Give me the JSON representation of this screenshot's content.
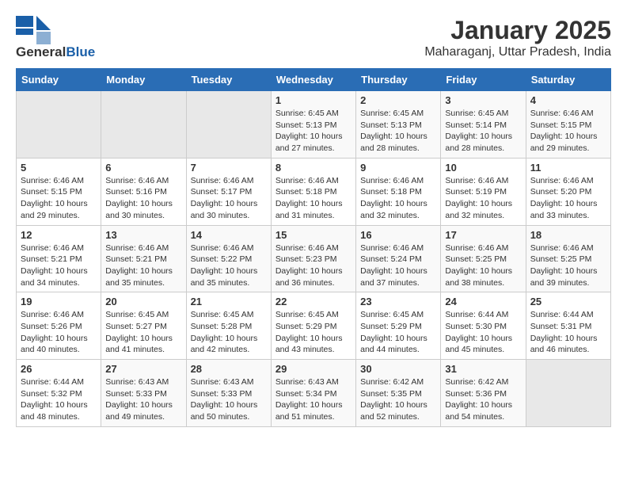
{
  "header": {
    "logo_general": "General",
    "logo_blue": "Blue",
    "title": "January 2025",
    "subtitle": "Maharaganj, Uttar Pradesh, India"
  },
  "calendar": {
    "days_of_week": [
      "Sunday",
      "Monday",
      "Tuesday",
      "Wednesday",
      "Thursday",
      "Friday",
      "Saturday"
    ],
    "weeks": [
      [
        {
          "day": "",
          "info": ""
        },
        {
          "day": "",
          "info": ""
        },
        {
          "day": "",
          "info": ""
        },
        {
          "day": "1",
          "info": "Sunrise: 6:45 AM\nSunset: 5:13 PM\nDaylight: 10 hours\nand 27 minutes."
        },
        {
          "day": "2",
          "info": "Sunrise: 6:45 AM\nSunset: 5:13 PM\nDaylight: 10 hours\nand 28 minutes."
        },
        {
          "day": "3",
          "info": "Sunrise: 6:45 AM\nSunset: 5:14 PM\nDaylight: 10 hours\nand 28 minutes."
        },
        {
          "day": "4",
          "info": "Sunrise: 6:46 AM\nSunset: 5:15 PM\nDaylight: 10 hours\nand 29 minutes."
        }
      ],
      [
        {
          "day": "5",
          "info": "Sunrise: 6:46 AM\nSunset: 5:15 PM\nDaylight: 10 hours\nand 29 minutes."
        },
        {
          "day": "6",
          "info": "Sunrise: 6:46 AM\nSunset: 5:16 PM\nDaylight: 10 hours\nand 30 minutes."
        },
        {
          "day": "7",
          "info": "Sunrise: 6:46 AM\nSunset: 5:17 PM\nDaylight: 10 hours\nand 30 minutes."
        },
        {
          "day": "8",
          "info": "Sunrise: 6:46 AM\nSunset: 5:18 PM\nDaylight: 10 hours\nand 31 minutes."
        },
        {
          "day": "9",
          "info": "Sunrise: 6:46 AM\nSunset: 5:18 PM\nDaylight: 10 hours\nand 32 minutes."
        },
        {
          "day": "10",
          "info": "Sunrise: 6:46 AM\nSunset: 5:19 PM\nDaylight: 10 hours\nand 32 minutes."
        },
        {
          "day": "11",
          "info": "Sunrise: 6:46 AM\nSunset: 5:20 PM\nDaylight: 10 hours\nand 33 minutes."
        }
      ],
      [
        {
          "day": "12",
          "info": "Sunrise: 6:46 AM\nSunset: 5:21 PM\nDaylight: 10 hours\nand 34 minutes."
        },
        {
          "day": "13",
          "info": "Sunrise: 6:46 AM\nSunset: 5:21 PM\nDaylight: 10 hours\nand 35 minutes."
        },
        {
          "day": "14",
          "info": "Sunrise: 6:46 AM\nSunset: 5:22 PM\nDaylight: 10 hours\nand 35 minutes."
        },
        {
          "day": "15",
          "info": "Sunrise: 6:46 AM\nSunset: 5:23 PM\nDaylight: 10 hours\nand 36 minutes."
        },
        {
          "day": "16",
          "info": "Sunrise: 6:46 AM\nSunset: 5:24 PM\nDaylight: 10 hours\nand 37 minutes."
        },
        {
          "day": "17",
          "info": "Sunrise: 6:46 AM\nSunset: 5:25 PM\nDaylight: 10 hours\nand 38 minutes."
        },
        {
          "day": "18",
          "info": "Sunrise: 6:46 AM\nSunset: 5:25 PM\nDaylight: 10 hours\nand 39 minutes."
        }
      ],
      [
        {
          "day": "19",
          "info": "Sunrise: 6:46 AM\nSunset: 5:26 PM\nDaylight: 10 hours\nand 40 minutes."
        },
        {
          "day": "20",
          "info": "Sunrise: 6:45 AM\nSunset: 5:27 PM\nDaylight: 10 hours\nand 41 minutes."
        },
        {
          "day": "21",
          "info": "Sunrise: 6:45 AM\nSunset: 5:28 PM\nDaylight: 10 hours\nand 42 minutes."
        },
        {
          "day": "22",
          "info": "Sunrise: 6:45 AM\nSunset: 5:29 PM\nDaylight: 10 hours\nand 43 minutes."
        },
        {
          "day": "23",
          "info": "Sunrise: 6:45 AM\nSunset: 5:29 PM\nDaylight: 10 hours\nand 44 minutes."
        },
        {
          "day": "24",
          "info": "Sunrise: 6:44 AM\nSunset: 5:30 PM\nDaylight: 10 hours\nand 45 minutes."
        },
        {
          "day": "25",
          "info": "Sunrise: 6:44 AM\nSunset: 5:31 PM\nDaylight: 10 hours\nand 46 minutes."
        }
      ],
      [
        {
          "day": "26",
          "info": "Sunrise: 6:44 AM\nSunset: 5:32 PM\nDaylight: 10 hours\nand 48 minutes."
        },
        {
          "day": "27",
          "info": "Sunrise: 6:43 AM\nSunset: 5:33 PM\nDaylight: 10 hours\nand 49 minutes."
        },
        {
          "day": "28",
          "info": "Sunrise: 6:43 AM\nSunset: 5:33 PM\nDaylight: 10 hours\nand 50 minutes."
        },
        {
          "day": "29",
          "info": "Sunrise: 6:43 AM\nSunset: 5:34 PM\nDaylight: 10 hours\nand 51 minutes."
        },
        {
          "day": "30",
          "info": "Sunrise: 6:42 AM\nSunset: 5:35 PM\nDaylight: 10 hours\nand 52 minutes."
        },
        {
          "day": "31",
          "info": "Sunrise: 6:42 AM\nSunset: 5:36 PM\nDaylight: 10 hours\nand 54 minutes."
        },
        {
          "day": "",
          "info": ""
        }
      ]
    ]
  }
}
